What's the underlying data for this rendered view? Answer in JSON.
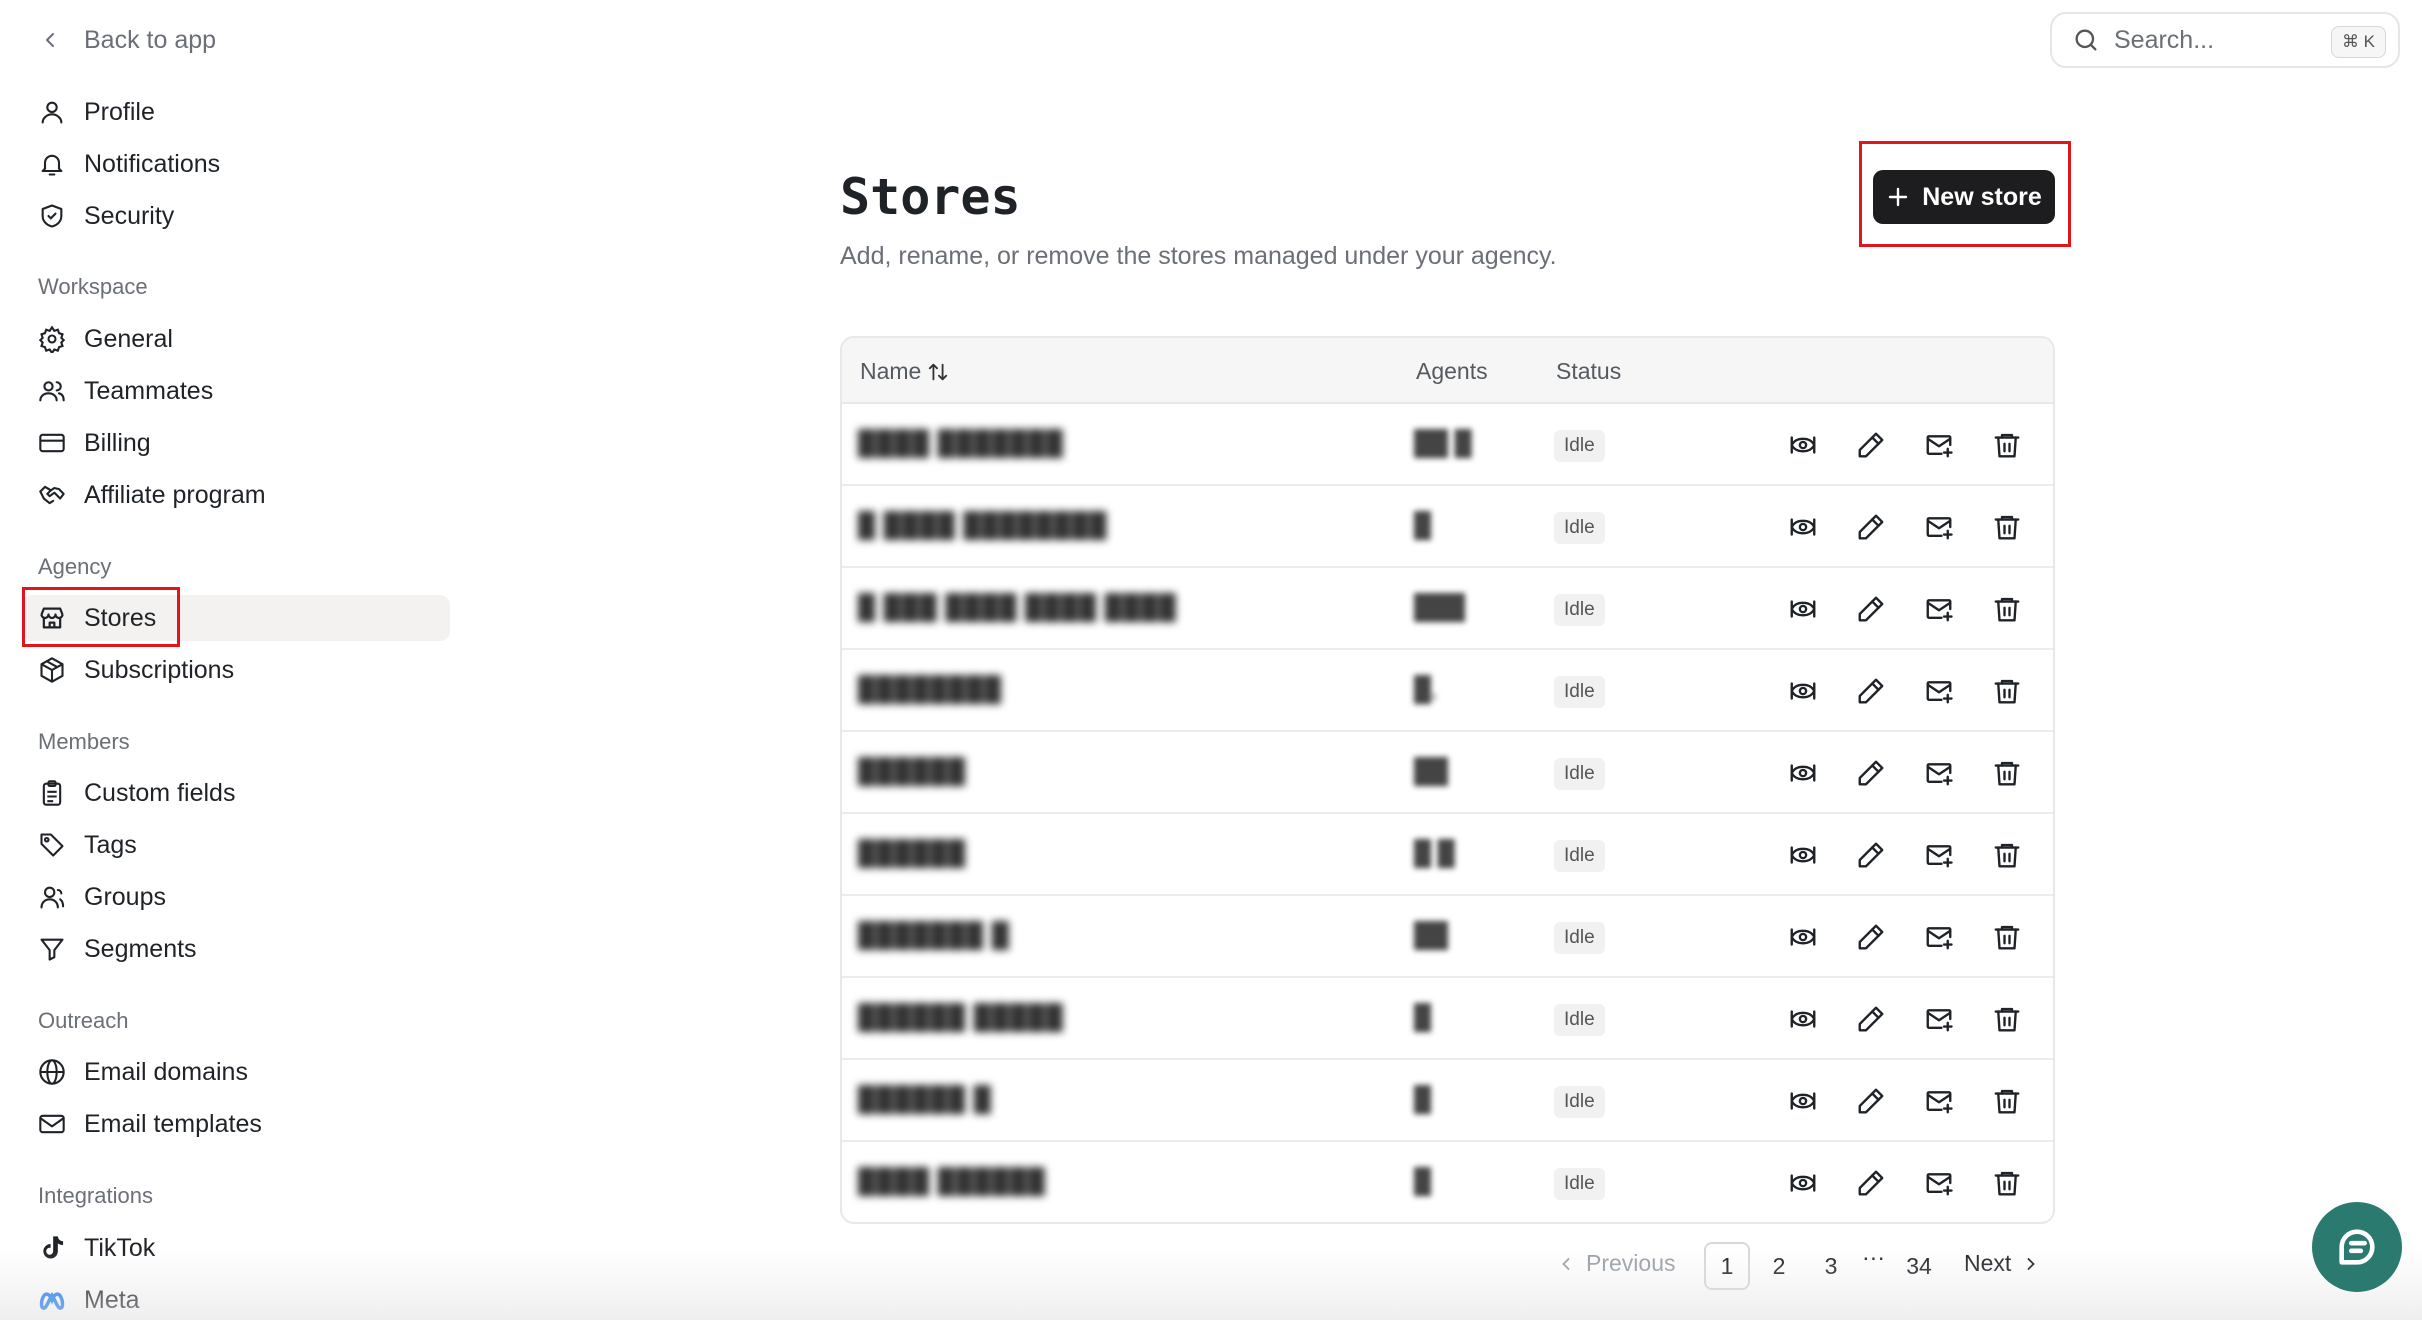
{
  "nav": {
    "back_label": "Back to app",
    "top_items": [
      {
        "label": "Profile",
        "icon": "user-icon"
      },
      {
        "label": "Notifications",
        "icon": "bell-icon"
      },
      {
        "label": "Security",
        "icon": "shield-icon"
      }
    ],
    "sections": [
      {
        "title": "Workspace",
        "items": [
          {
            "label": "General",
            "icon": "gear-icon"
          },
          {
            "label": "Teammates",
            "icon": "users-icon"
          },
          {
            "label": "Billing",
            "icon": "credit-card-icon"
          },
          {
            "label": "Affiliate program",
            "icon": "handshake-icon"
          }
        ]
      },
      {
        "title": "Agency",
        "items": [
          {
            "label": "Stores",
            "icon": "store-icon",
            "active": true
          },
          {
            "label": "Subscriptions",
            "icon": "package-icon"
          }
        ]
      },
      {
        "title": "Members",
        "items": [
          {
            "label": "Custom fields",
            "icon": "clipboard-icon"
          },
          {
            "label": "Tags",
            "icon": "tag-icon"
          },
          {
            "label": "Groups",
            "icon": "group-icon"
          },
          {
            "label": "Segments",
            "icon": "filter-icon"
          }
        ]
      },
      {
        "title": "Outreach",
        "items": [
          {
            "label": "Email domains",
            "icon": "globe-icon"
          },
          {
            "label": "Email templates",
            "icon": "mail-icon"
          }
        ]
      },
      {
        "title": "Integrations",
        "items": [
          {
            "label": "TikTok",
            "icon": "tiktok-icon"
          },
          {
            "label": "Meta",
            "icon": "meta-icon"
          }
        ]
      }
    ]
  },
  "search": {
    "placeholder": "Search...",
    "shortcut": "⌘ K"
  },
  "page": {
    "title": "Stores",
    "subtitle": "Add, rename, or remove the stores managed under your agency.",
    "new_store_label": "New store"
  },
  "table": {
    "columns": {
      "name": "Name",
      "agents": "Agents",
      "status": "Status"
    },
    "rows": [
      {
        "name": "████ ███████",
        "agents": "██ █",
        "status": "Idle"
      },
      {
        "name": "█ ████ ████████",
        "agents": "█",
        "status": "Idle"
      },
      {
        "name": "█ ███ ████ ████ ████",
        "agents": "███",
        "status": "Idle"
      },
      {
        "name": "████████",
        "agents": "█,",
        "status": "Idle"
      },
      {
        "name": "██████",
        "agents": "██",
        "status": "Idle"
      },
      {
        "name": "██████",
        "agents": "█ █",
        "status": "Idle"
      },
      {
        "name": "███████ █",
        "agents": "██",
        "status": "Idle"
      },
      {
        "name": "██████ █████",
        "agents": "█",
        "status": "Idle"
      },
      {
        "name": "██████ █",
        "agents": "█",
        "status": "Idle"
      },
      {
        "name": "████ ██████",
        "agents": "█",
        "status": "Idle"
      }
    ]
  },
  "pagination": {
    "prev_label": "Previous",
    "next_label": "Next",
    "pages": [
      "1",
      "2",
      "3"
    ],
    "ellipsis": "···",
    "last_page": "34",
    "current": "1"
  }
}
